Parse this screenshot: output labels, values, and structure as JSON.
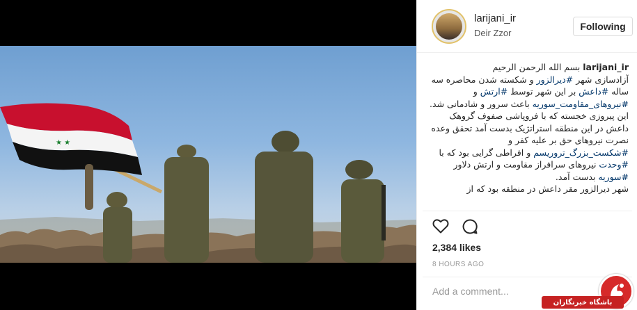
{
  "post": {
    "username": "larijani_ir",
    "location": "Deir Zzor",
    "follow_label": "Following",
    "likes": "2,384 likes",
    "timestamp": "8 HOURS AGO",
    "comment_placeholder": "Add a comment..."
  },
  "caption": {
    "user": "larijani_ir",
    "greeting": "بسم الله الرحمن الرحیم",
    "p1_a": "آزادسازی شهر ",
    "p1_tag1": "#دیرالزور",
    "p1_b": " و شکسته شدن محاصره سه ساله ",
    "p1_tag2": "#داعش",
    "p1_c": " بر این شهر توسط ",
    "p1_tag3": "#ارتش",
    "p1_d": " و ",
    "p1_tag4": "#نیروهای_مقاومت_سوریه",
    "p1_e": " باعث سرور و شادمانی شد.",
    "p2_a": "این پیروزی خجسته که با فروپاشی صفوف گروهک داعش در این منطقه استراتژیک بدست آمد تحقق وعده نصرت نیروهای حق بر علیه کفر و ",
    "p2_tag1": "#شکست_بزرگ_تروریسم",
    "p2_b": " و افراطی گرایی بود که با ",
    "p2_tag2": "#وحدت",
    "p2_c": " نیروهای سرافراز مقاومت و ارتش دلاور ",
    "p2_tag3": "#سوریه",
    "p2_d": " بدست آمد.",
    "p3": "شهر دیرالزور مقر داعش در منطقه بود که از"
  },
  "watermark": {
    "text": "باشگاه خبرنگاران"
  },
  "icons": {
    "like": "heart-icon",
    "comment": "comment-icon"
  },
  "colors": {
    "hashtag": "#003569",
    "watermark_red": "#c62222"
  }
}
